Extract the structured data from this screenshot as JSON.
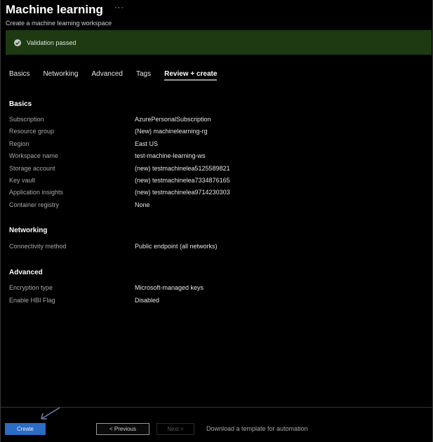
{
  "header": {
    "title": "Machine learning",
    "more": "···",
    "subtitle": "Create a machine learning workspace"
  },
  "banner": {
    "icon": "check-circle-icon",
    "text": "Validation passed",
    "color": "#1e3a12"
  },
  "tabs": [
    {
      "label": "Basics",
      "active": false
    },
    {
      "label": "Networking",
      "active": false
    },
    {
      "label": "Advanced",
      "active": false
    },
    {
      "label": "Tags",
      "active": false
    },
    {
      "label": "Review + create",
      "active": true
    }
  ],
  "sections": {
    "basics": {
      "title": "Basics",
      "rows": [
        {
          "label": "Subscription",
          "value": "AzurePersonalSubscription"
        },
        {
          "label": "Resource group",
          "value": "(New) machinelearning-rg"
        },
        {
          "label": "Region",
          "value": "East US"
        },
        {
          "label": "Workspace name",
          "value": "test-machine-learning-ws"
        },
        {
          "label": "Storage account",
          "value": "(new) testmachinelea5125589821"
        },
        {
          "label": "Key vault",
          "value": "(new) testmachinelea7334876165"
        },
        {
          "label": "Application insights",
          "value": "(new) testmachinelea9714230303"
        },
        {
          "label": "Container registry",
          "value": "None"
        }
      ]
    },
    "networking": {
      "title": "Networking",
      "rows": [
        {
          "label": "Connectivity method",
          "value": "Public endpoint (all networks)"
        }
      ]
    },
    "advanced": {
      "title": "Advanced",
      "rows": [
        {
          "label": "Encryption type",
          "value": "Microsoft-managed keys"
        },
        {
          "label": "Enable HBI Flag",
          "value": "Disabled"
        }
      ]
    }
  },
  "footer": {
    "create_label": "Create",
    "previous_label": "< Previous",
    "next_label": "Next >",
    "download_label": "Download a template for automation",
    "accent": "#2b6cc4"
  }
}
